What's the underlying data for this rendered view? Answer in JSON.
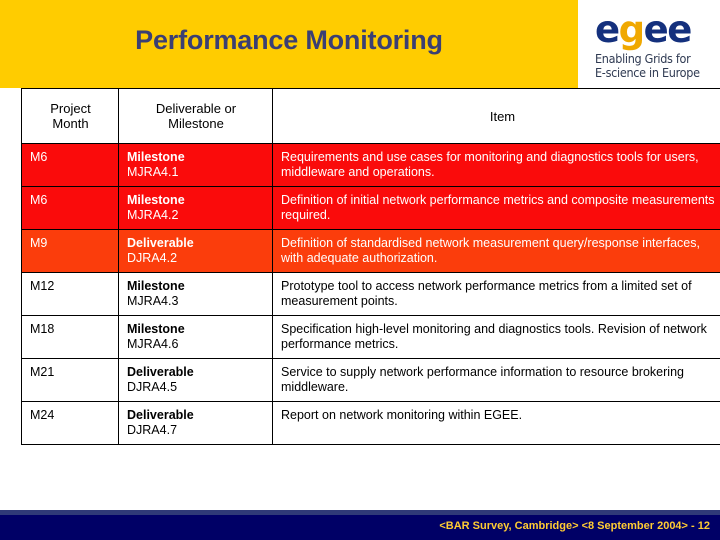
{
  "slide": {
    "title": "Performance Monitoring"
  },
  "logo": {
    "wordmark_part1": "e",
    "wordmark_gold": "g",
    "wordmark_part2": "ee",
    "tagline_line1": "Enabling Grids for",
    "tagline_line2": "E-science in Europe",
    "navy": "#14307d",
    "gold": "#f0a800"
  },
  "table": {
    "headers": [
      "Project\nMonth",
      "Deliverable or\nMilestone",
      "Item"
    ],
    "header_month_line1": "Project",
    "header_month_line2": "Month",
    "header_type_line1": "Deliverable or",
    "header_type_line2": "Milestone",
    "header_item": "Item",
    "rows": [
      {
        "month": "M6",
        "type_name": "Milestone",
        "type_code": "MJRA4.1",
        "item": "Requirements and use cases for monitoring and diagnostics tools for users, middleware and operations.",
        "highlight": "red"
      },
      {
        "month": "M6",
        "type_name": "Milestone",
        "type_code": "MJRA4.2",
        "item": "Definition of initial network performance metrics and composite measurements required.",
        "highlight": "red"
      },
      {
        "month": "M9",
        "type_name": "Deliverable",
        "type_code": "DJRA4.2",
        "item": "Definition of standardised network measurement query/response interfaces, with adequate authorization.",
        "highlight": "orange"
      },
      {
        "month": "M12",
        "type_name": "Milestone",
        "type_code": "MJRA4.3",
        "item": "Prototype tool to access network performance metrics from a limited set of measurement points.",
        "highlight": "none"
      },
      {
        "month": "M18",
        "type_name": "Milestone",
        "type_code": "MJRA4.6",
        "item": "Specification high-level monitoring and diagnostics tools. Revision of network performance metrics.",
        "highlight": "none"
      },
      {
        "month": "M21",
        "type_name": "Deliverable",
        "type_code": "DJRA4.5",
        "item": "Service to supply network performance information to resource brokering middleware.",
        "highlight": "none"
      },
      {
        "month": "M24",
        "type_name": "Deliverable",
        "type_code": "DJRA4.7",
        "item": "Report on network monitoring within EGEE.",
        "highlight": "none"
      }
    ]
  },
  "footer": {
    "text": "<BAR Survey, Cambridge> <8 September 2004>  -  12",
    "background": "#000066",
    "text_color": "#ffcc33"
  },
  "colors": {
    "header_band": "#ffcc00",
    "title_text": "#3b3f73",
    "row_red": "#fa0b0b",
    "row_orange": "#fb3d0c"
  }
}
